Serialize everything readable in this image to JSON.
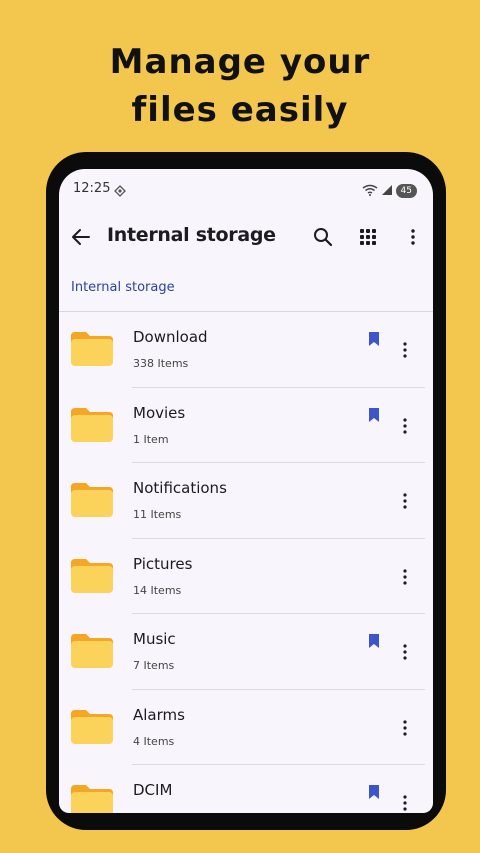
{
  "promo": {
    "line1": "Manage your",
    "line2": "files easily"
  },
  "statusbar": {
    "time": "12:25",
    "battery": "45"
  },
  "appbar": {
    "title": "Internal storage",
    "icons": [
      "back-arrow-icon",
      "search-icon",
      "grid-view-icon",
      "more-vert-icon"
    ]
  },
  "breadcrumb": "Internal storage",
  "folders": [
    {
      "name": "Download",
      "count": "338 Items",
      "bookmarked": true
    },
    {
      "name": "Movies",
      "count": "1 Item",
      "bookmarked": true
    },
    {
      "name": "Notifications",
      "count": "11 Items",
      "bookmarked": false
    },
    {
      "name": "Pictures",
      "count": "14 Items",
      "bookmarked": false
    },
    {
      "name": "Music",
      "count": "7 Items",
      "bookmarked": true
    },
    {
      "name": "Alarms",
      "count": "4 Items",
      "bookmarked": false
    },
    {
      "name": "DCIM",
      "count": "",
      "bookmarked": true
    }
  ],
  "colors": {
    "background": "#F3C64D",
    "folder": "#FBD25A",
    "folder_tab": "#F5A623",
    "bookmark": "#3C55C8",
    "breadcrumb": "#2744A8"
  }
}
